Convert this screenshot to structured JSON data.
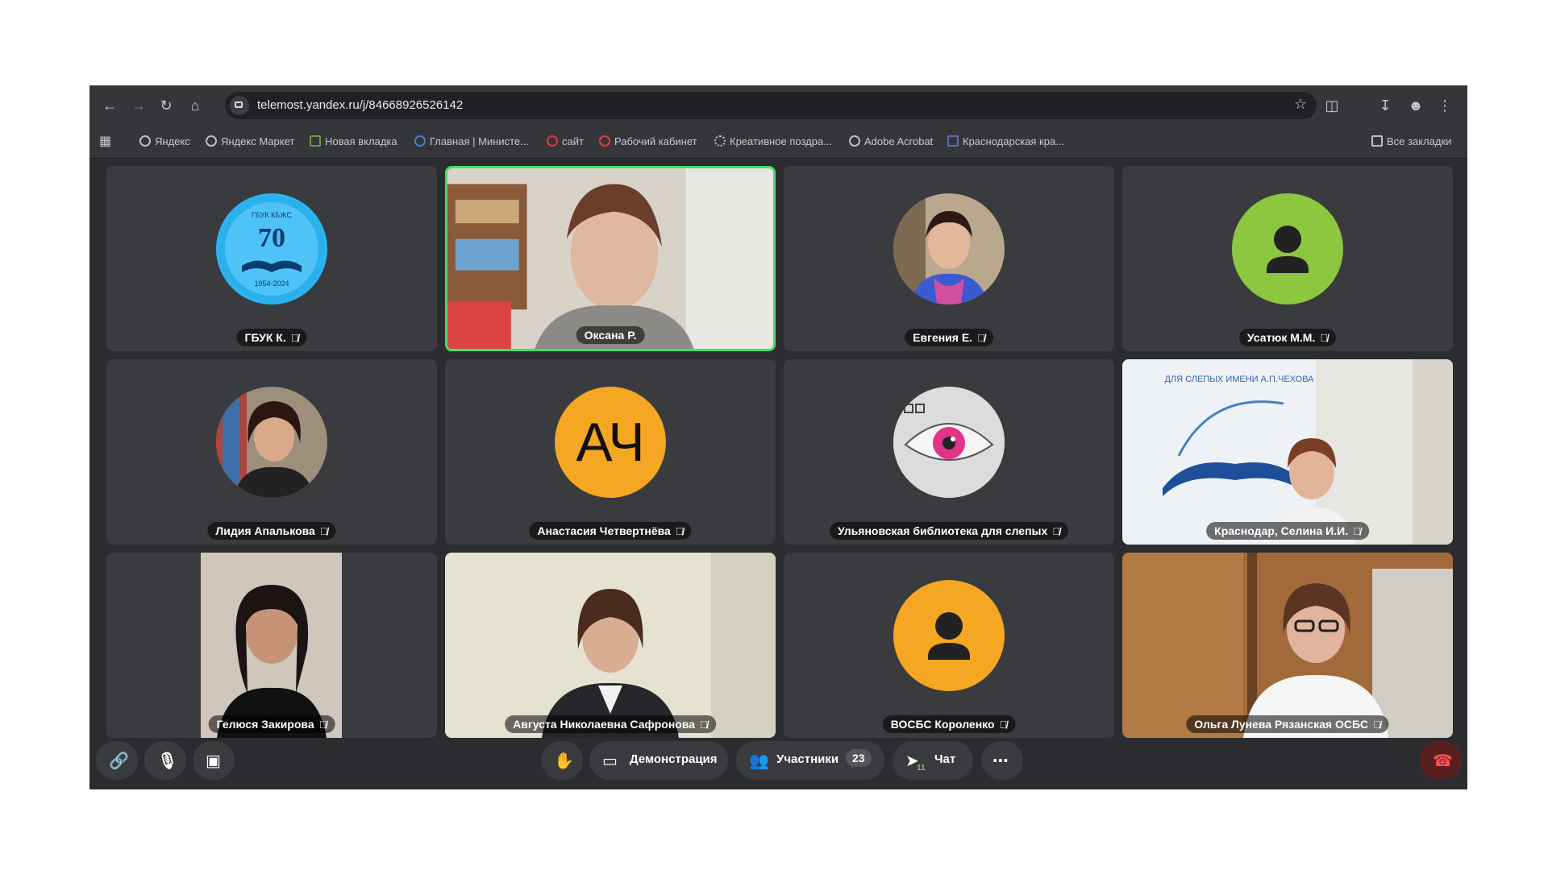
{
  "browser": {
    "url": "telemost.yandex.ru/j/84668926526142",
    "bookmarks": [
      "Яндекс",
      "Яндекс Маркет",
      "Новая вкладка",
      "Главная | Министе...",
      "сайт",
      "Рабочий кабинет",
      "Креативное поздра...",
      "Adobe Acrobat",
      "Краснодарская кра..."
    ],
    "all_bookmarks": "Все закладки"
  },
  "tiles": [
    {
      "name": "ГБУК К.",
      "avatar": "logo-70"
    },
    {
      "name": "Оксана Р.",
      "avatar": "video",
      "speaking": true
    },
    {
      "name": "Евгения Е.",
      "avatar": "photo"
    },
    {
      "name": "Усатюк М.М.",
      "avatar": "default-green"
    },
    {
      "name": "Лидия Апалькова",
      "avatar": "photo"
    },
    {
      "name": "Анастасия Четвертнёва",
      "avatar": "initials",
      "initials": "АЧ"
    },
    {
      "name": "Ульяновская библиотека для слепых",
      "avatar": "eye"
    },
    {
      "name": "Краснодар, Селина И.И.",
      "avatar": "video"
    },
    {
      "name": "Гелюся Закирова",
      "avatar": "video"
    },
    {
      "name": "Августа Николаевна Сафронова",
      "avatar": "video"
    },
    {
      "name": "ВОСБС Короленко",
      "avatar": "default-orange"
    },
    {
      "name": "Ольга Лунева Рязанская ОСБС",
      "avatar": "video"
    }
  ],
  "logo_tile": {
    "top_text": "ГБУК КБЖС",
    "number": "70",
    "years": "1954-2024"
  },
  "banner_text": "ДЛЯ СЛЕПЫХ ИМЕНИ А.П.ЧЕХОВА",
  "controls": {
    "demo_label": "Демонстрация",
    "participants_label": "Участники",
    "participants_count": "23",
    "chat_label": "Чат",
    "chat_badge": "11"
  },
  "colors": {
    "accent_speaking": "#3de070",
    "avatar_green": "#8dc63f",
    "avatar_orange": "#f5a623",
    "hangup": "#e53935"
  }
}
